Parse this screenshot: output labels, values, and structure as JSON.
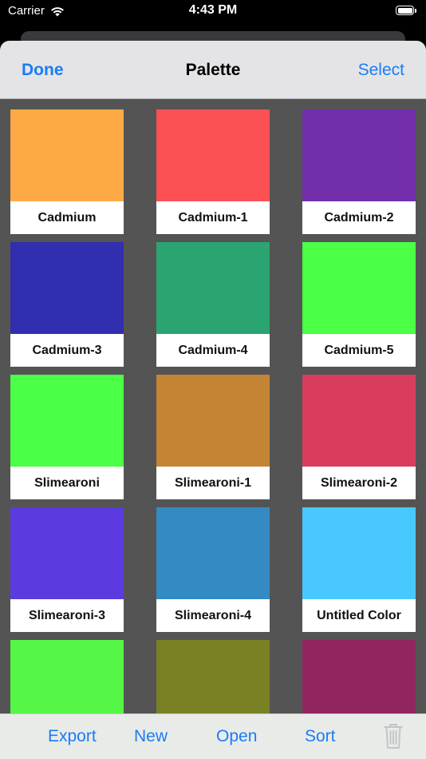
{
  "status_bar": {
    "carrier": "Carrier",
    "time": "4:43 PM",
    "battery_level": 1.0
  },
  "nav": {
    "left_button": "Done",
    "title": "Palette",
    "right_button": "Select"
  },
  "colors": {
    "accent": "#1a7cf5",
    "grid_background": "#545454",
    "nav_background": "#e4e4e6",
    "toolbar_background": "#e9ebe9",
    "trash_disabled": "#c4c4c6"
  },
  "swatches": [
    {
      "name": "Cadmium",
      "color": "#fcaa45"
    },
    {
      "name": "Cadmium-1",
      "color": "#fc5055"
    },
    {
      "name": "Cadmium-2",
      "color": "#722eab"
    },
    {
      "name": "Cadmium-3",
      "color": "#312eb0"
    },
    {
      "name": "Cadmium-4",
      "color": "#2aa571"
    },
    {
      "name": "Cadmium-5",
      "color": "#4aff46"
    },
    {
      "name": "Slimearoni",
      "color": "#4bff46"
    },
    {
      "name": "Slimearoni-1",
      "color": "#c38534"
    },
    {
      "name": "Slimearoni-2",
      "color": "#d93d5e"
    },
    {
      "name": "Slimearoni-3",
      "color": "#5b3be0"
    },
    {
      "name": "Slimearoni-4",
      "color": "#348bc3"
    },
    {
      "name": "Untitled Color",
      "color": "#49c8ff"
    },
    {
      "name": "",
      "color": "#56f646"
    },
    {
      "name": "",
      "color": "#7a8124"
    },
    {
      "name": "",
      "color": "#912560"
    }
  ],
  "toolbar": {
    "export": "Export",
    "new": "New",
    "open": "Open",
    "sort": "Sort",
    "trash_icon": "trash-icon"
  }
}
